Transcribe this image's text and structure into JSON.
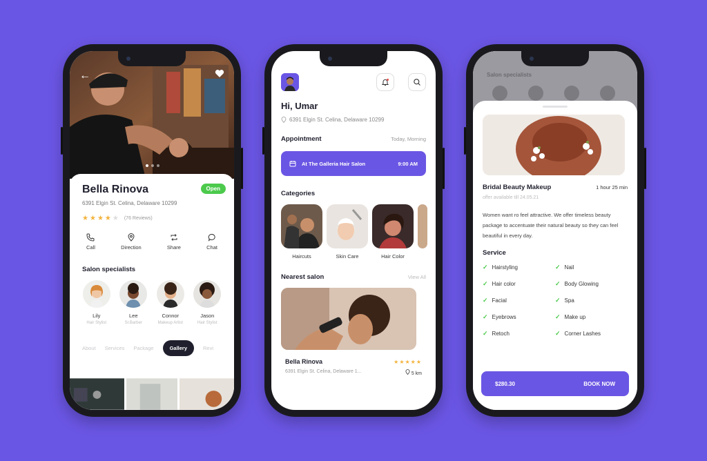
{
  "colors": {
    "background": "#6a56e4",
    "accent": "#6a56e4",
    "open_green": "#4cca4c",
    "star": "#f3b33d",
    "dark": "#1f1f2e"
  },
  "detail": {
    "back_icon": "arrow-left-icon",
    "favorite_icon": "heart-icon",
    "name": "Bella Rinova",
    "status": "Open",
    "address": "6391 Elgin St. Celina, Delaware 10299",
    "rating": 4,
    "rating_max": 5,
    "reviews": "(76 Reviews)",
    "actions": [
      {
        "label": "Call",
        "icon": "phone-icon"
      },
      {
        "label": "Direction",
        "icon": "location-pin-icon"
      },
      {
        "label": "Share",
        "icon": "share-icon"
      },
      {
        "label": "Chat",
        "icon": "chat-icon"
      }
    ],
    "specialists_title": "Salon specialists",
    "specialists": [
      {
        "name": "Lily",
        "role": "Hair Stylist"
      },
      {
        "name": "Lee",
        "role": "Sr.Barber"
      },
      {
        "name": "Connor",
        "role": "Makeup Artist"
      },
      {
        "name": "Jason",
        "role": "Hair Stylist"
      }
    ],
    "tabs": [
      "About",
      "Services",
      "Package",
      "Gallery",
      "Revi"
    ],
    "active_tab": "Gallery"
  },
  "home": {
    "greeting": "Hi, Umar",
    "location": "6391 Elgin St. Celina, Delaware 10299",
    "appointment_title": "Appointment",
    "appointment_when": "Today, Morning",
    "appointment_salon": "At The Galleria Hair Salon",
    "appointment_time": "9:00 AM",
    "categories_title": "Categories",
    "categories": [
      {
        "label": "Haircuts"
      },
      {
        "label": "Skin Care"
      },
      {
        "label": "Hair Color"
      }
    ],
    "nearest_title": "Nearest salon",
    "view_all": "View All",
    "salon_name": "Bella Rinova",
    "salon_address": "6391 Elgin St. Celina, Delaware 1...",
    "salon_distance": "5 km",
    "salon_rating": 5
  },
  "service": {
    "title": "Bridal Beauty Makeup",
    "duration": "1 hour 25 min",
    "offer": "offer available till 24.05.21",
    "description": "Women want ro feel  attractive. We offer timeless beauty package to accentuate their natural beauty so they can feel beautiful in every day.",
    "services_title": "Service",
    "services": [
      "Hairstyling",
      "Nail",
      "Hair color",
      "Body Glowing",
      "Facial",
      "Spa",
      "Eyebrows",
      "Make up",
      "Retoch",
      "Corner Lashes"
    ],
    "price": "$280.30",
    "cta": "BOOK NOW",
    "background_label": "Salon specialists"
  }
}
